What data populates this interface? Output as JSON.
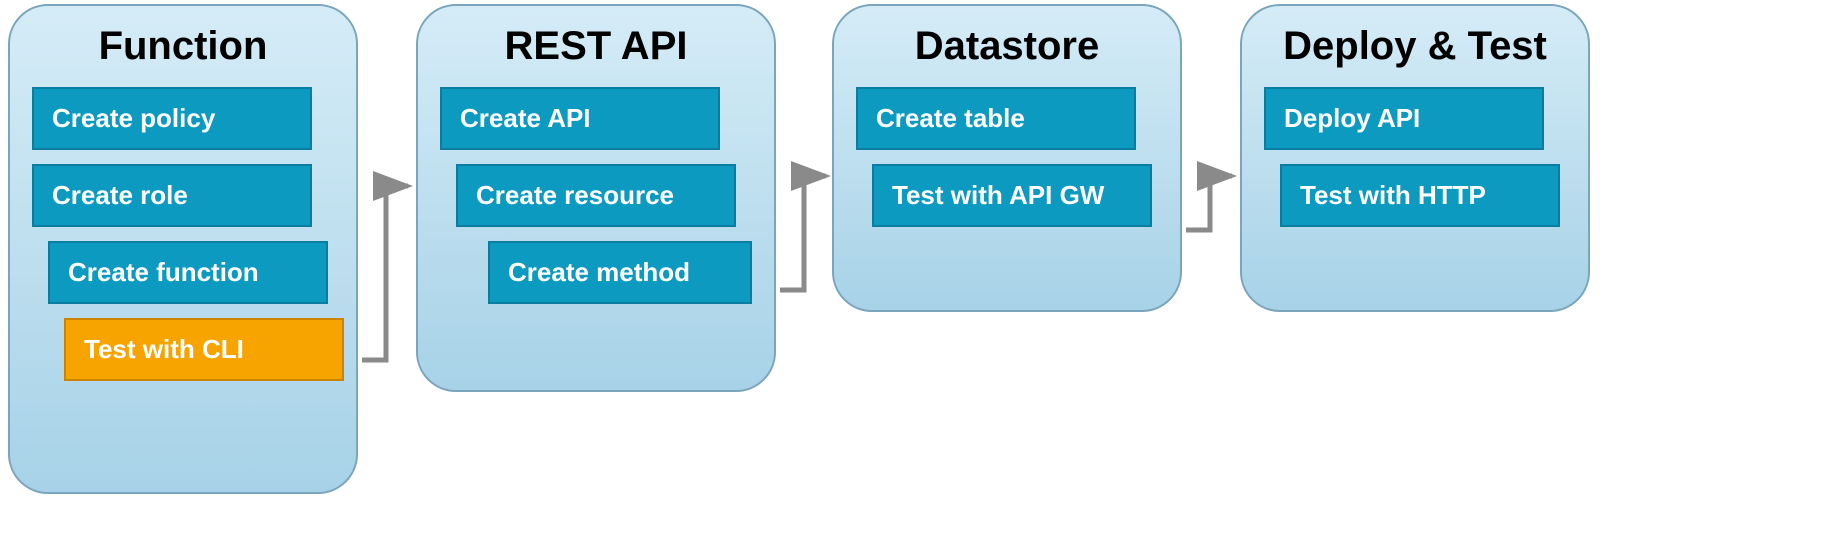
{
  "colors": {
    "step": "#0d9ac1",
    "highlight": "#f7a300",
    "panel_border": "#7aa5bc",
    "arrow": "#8a8a8a"
  },
  "stages": [
    {
      "title": "Function",
      "steps": [
        {
          "label": "Create policy",
          "indent": 0,
          "highlight": false
        },
        {
          "label": "Create role",
          "indent": 0,
          "highlight": false
        },
        {
          "label": "Create function",
          "indent": 1,
          "highlight": false
        },
        {
          "label": "Test with CLI",
          "indent": 2,
          "highlight": true
        }
      ]
    },
    {
      "title": "REST API",
      "steps": [
        {
          "label": "Create API",
          "indent": 0,
          "highlight": false
        },
        {
          "label": "Create resource",
          "indent": 1,
          "highlight": false
        },
        {
          "label": "Create method",
          "indent": 3,
          "highlight": false
        }
      ]
    },
    {
      "title": "Datastore",
      "steps": [
        {
          "label": "Create table",
          "indent": 0,
          "highlight": false
        },
        {
          "label": "Test with API GW",
          "indent": 1,
          "highlight": false
        }
      ]
    },
    {
      "title": "Deploy & Test",
      "steps": [
        {
          "label": "Deploy API",
          "indent": 0,
          "highlight": false
        },
        {
          "label": "Test with HTTP",
          "indent": 1,
          "highlight": false
        }
      ]
    }
  ]
}
